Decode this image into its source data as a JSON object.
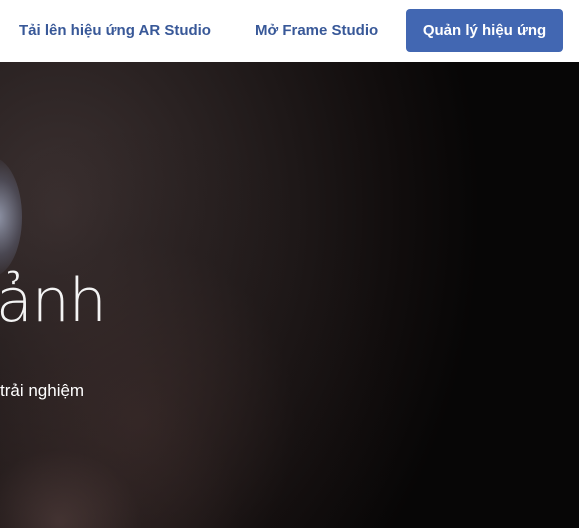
{
  "nav": {
    "upload_label": "Tải lên hiệu ứng AR Studio",
    "frame_label": "Mở Frame Studio",
    "manage_label": "Quản lý hiệu ứng"
  },
  "hero": {
    "heading": "ảnh",
    "subtext": "trải nghiệm"
  },
  "colors": {
    "link": "#385898",
    "button": "#4267b2",
    "button_text": "#ffffff",
    "hero_background": "#050505",
    "hero_text": "#ffffff"
  }
}
